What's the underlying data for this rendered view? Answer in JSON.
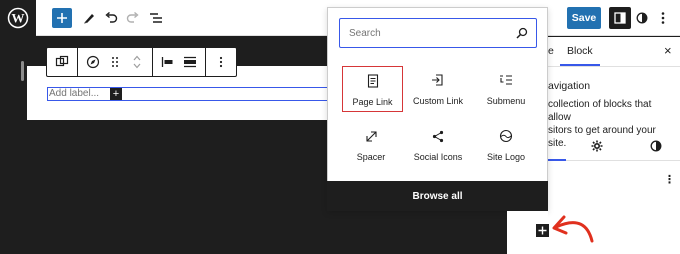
{
  "toolbar": {
    "save_label": "Save"
  },
  "block": {
    "label_placeholder": "Add label...",
    "add_symbol": "+"
  },
  "inserter": {
    "search_placeholder": "Search",
    "items": [
      {
        "label": "Page Link",
        "icon": "page-icon",
        "selected": true
      },
      {
        "label": "Custom Link",
        "icon": "custom-link-icon",
        "selected": false
      },
      {
        "label": "Submenu",
        "icon": "submenu-icon",
        "selected": false
      },
      {
        "label": "Spacer",
        "icon": "spacer-icon",
        "selected": false
      },
      {
        "label": "Social Icons",
        "icon": "share-icon",
        "selected": false
      },
      {
        "label": "Site Logo",
        "icon": "site-logo-icon",
        "selected": false
      }
    ],
    "browse_all_label": "Browse all"
  },
  "sidebar": {
    "tab_partial": "e",
    "tab_block": "Block",
    "close_symbol": "×",
    "title_partial": "avigation",
    "desc_line1": "collection of blocks that allow",
    "desc_line2": "sitors to get around your site.",
    "more_symbol": "⋮"
  },
  "colors": {
    "accent": "#2271b1",
    "selection": "#3858e9",
    "highlight": "#d63638",
    "dark": "#1e1e1e"
  }
}
